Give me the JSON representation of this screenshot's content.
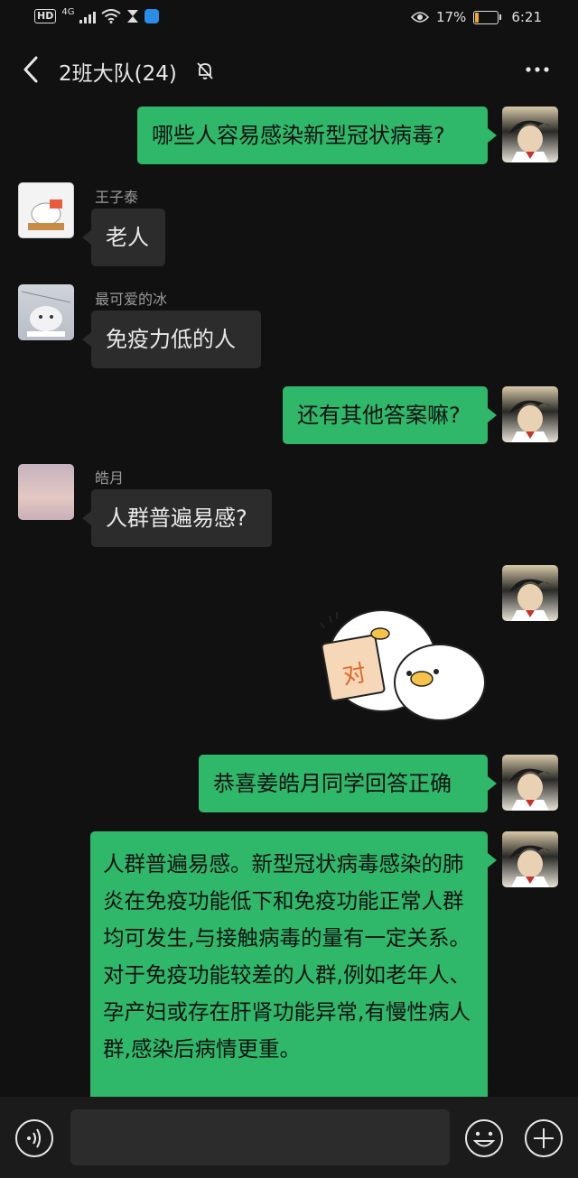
{
  "status": {
    "battery_pct": "17%",
    "time": "6:21",
    "network": "4G",
    "hd": "HD",
    "battery_level": 0.17
  },
  "header": {
    "title": "2班大队(24)"
  },
  "messages": [
    {
      "side": "right",
      "text": "哪些人容易感染新型冠状病毒?"
    },
    {
      "side": "left",
      "sender": "王子泰",
      "text": "老人"
    },
    {
      "side": "left",
      "sender": "最可爱的冰",
      "text": "免疫力低的人"
    },
    {
      "side": "right",
      "text": "还有其他答案嘛?"
    },
    {
      "side": "left",
      "sender": "皓月",
      "text": "人群普遍易感?"
    },
    {
      "side": "right",
      "sticker_text": "对"
    },
    {
      "side": "right",
      "text": "恭喜姜皓月同学回答正确"
    },
    {
      "side": "right",
      "text": "人群普遍易感。新型冠状病毒感染的肺炎在免疫功能低下和免疫功能正常人群均可发生,与接触病毒的量有一定关系。对于免疫功能较差的人群,例如老年人、孕产妇或存在肝肾功能异常,有慢性病人群,感染后病情更重。"
    }
  ],
  "colors": {
    "background": "#111111",
    "bubble_green": "#2fb86a",
    "bubble_gray": "#2c2c2c",
    "battery_accent": "#f5a623"
  },
  "icons": [
    "back-arrow-icon",
    "mute-bell-icon",
    "more-dots-icon",
    "voice-icon",
    "emoji-icon",
    "plus-icon",
    "wifi-icon",
    "eye-icon",
    "hourglass-icon"
  ]
}
